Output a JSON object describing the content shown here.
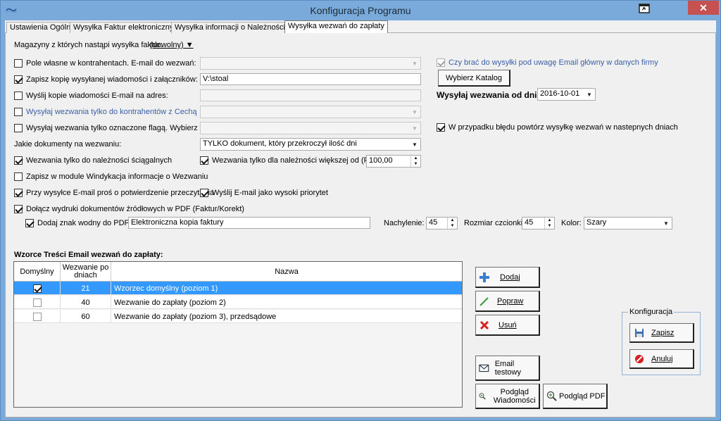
{
  "window": {
    "title": "Konfiguracja Programu",
    "close_glyph": "✕"
  },
  "tabs": [
    {
      "label": "Ustawienia Ogólne"
    },
    {
      "label": "Wysyłka Faktur elektronicznych"
    },
    {
      "label": "Wysyłka informacji o Należnościach"
    },
    {
      "label": "Wysyłka wezwań do zapłaty"
    }
  ],
  "form": {
    "warehouses_label": "Magazyny z których nastąpi wysyłka faktur:",
    "warehouses_value": "(dowolny) ▼",
    "own_field_label": "Pole własne w kontrahentach. E-mail do wezwań:",
    "save_copy_label": "Zapisz kopię wysyłanej wiadomości i załączników:",
    "save_copy_value": "V:\\stoal",
    "send_copy_label": "Wyślij kopie wiadomości E-mail na adres:",
    "send_copy_value": "",
    "feature_label": "Wysyłaj wezwania tylko do kontrahentów z Cechą ▼",
    "flag_label": "Wysyłaj wezwania tylko oznaczone flagą. Wybierz flagę:",
    "docs_label": "Jakie dokumenty na wezwaniu:",
    "docs_value": "TYLKO dokument, który przekroczył ilość dni",
    "collectable_label": "Wezwania tylko do należności ściągalnych",
    "greater_label": "Wezwania tylko dla należności większej od (PLN):",
    "greater_value": "100,00",
    "windykacja_label": "Zapisz w module Windykacja informacje o Wezwaniu",
    "read_receipt_label": "Przy wysyłce E-mail proś o potwierdzenie przeczytania",
    "high_priority_label": "Wyślij E-mail jako wysoki priorytet",
    "attach_pdf_label": "Dołącz wydruki dokumentów źródłowych w PDF (Faktur/Korekt)",
    "watermark_label": "Dodaj znak wodny do PDF:",
    "watermark_value": "Elektroniczna kopia faktury",
    "tilt_label": "Nachylenie:",
    "tilt_value": "45",
    "fontsize_label": "Rozmiar czcionki:",
    "fontsize_value": "45",
    "color_label": "Kolor:",
    "color_value": "Szary",
    "main_email_label": "Czy brać do wysyłki pod uwagę Email główny w danych firmy",
    "choose_dir_label": "Wybierz Katalog",
    "send_from_label": "Wysyłaj wezwania od dnia:",
    "send_from_value": "2016-10-01",
    "retry_label": "W przypadku błędu powtórz wysyłkę wezwań w nastepnych dniach"
  },
  "templates": {
    "title": "Wzorce Treści Email wezwań do zapłaty:",
    "columns": {
      "default": "Domyślny",
      "days": "Wezwanie po dniach",
      "name": "Nazwa"
    },
    "rows": [
      {
        "days": "21",
        "name": "Wzorzec domyślny (poziom 1)",
        "default": true
      },
      {
        "days": "40",
        "name": "Wezwanie do zapłaty (poziom 2)",
        "default": false
      },
      {
        "days": "60",
        "name": "Wezwanie do zapłaty (poziom 3), przedsądowe",
        "default": false
      }
    ]
  },
  "buttons": {
    "add": "Dodaj",
    "edit": "Popraw",
    "delete": "Usuń",
    "test_email": "Email testowy",
    "preview_msg": "Podgląd Wiadomości",
    "preview_pdf": "Podgląd PDF"
  },
  "config_group": {
    "title": "Konfiguracja",
    "save": "Zapisz",
    "cancel": "Anuluj"
  },
  "colors": {
    "titlebar": "#7aaad9",
    "selection": "#3399ff",
    "close": "#c75050",
    "link_blue": "#3a5fa6"
  }
}
